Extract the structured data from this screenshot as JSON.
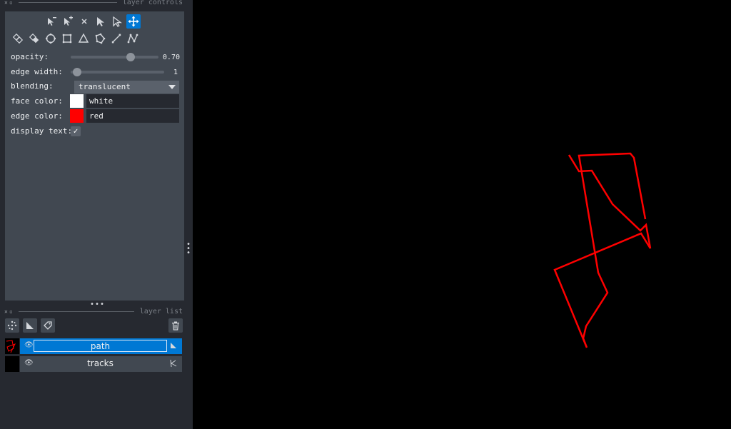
{
  "panels": {
    "controls_title": "layer controls",
    "list_title": "layer list"
  },
  "toolbar": {
    "row1": [
      "remove-point-icon",
      "add-point-icon",
      "delete-icon",
      "select-icon",
      "direct-select-icon",
      "pan-zoom-icon"
    ],
    "row2": [
      "move-back-icon",
      "move-front-icon",
      "ellipse-icon",
      "rectangle-icon",
      "triangle-icon",
      "polygon-icon",
      "line-icon",
      "path-icon"
    ],
    "active_tool": "pan-zoom-icon"
  },
  "props": {
    "opacity_label": "opacity:",
    "opacity_value": "0.70",
    "opacity_fraction": 0.7,
    "edge_width_label": "edge width:",
    "edge_width_value": "1",
    "blending_label": "blending:",
    "blending_value": "translucent",
    "face_color_label": "face color:",
    "face_color_value": "white",
    "face_color_hex": "#ffffff",
    "edge_color_label": "edge color:",
    "edge_color_value": "red",
    "edge_color_hex": "#ff0000",
    "display_text_label": "display text:",
    "display_text_checked": true
  },
  "layer_buttons": [
    "new-points-icon",
    "new-shapes-icon",
    "new-labels-icon",
    "delete-layer-icon"
  ],
  "layers": [
    {
      "name": "path",
      "selected": true,
      "type_icon": "shapes-icon"
    },
    {
      "name": "tracks",
      "selected": false,
      "type_icon": "tracks-icon"
    }
  ],
  "colors": {
    "accent": "#0078d4",
    "panel_bg": "#262930",
    "control_bg": "#414851",
    "path_stroke": "#ff0000"
  }
}
